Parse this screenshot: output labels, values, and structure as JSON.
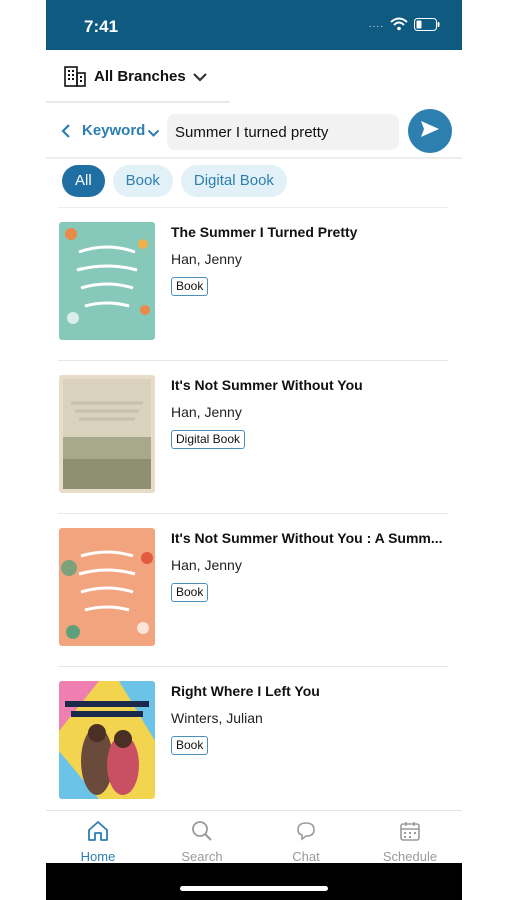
{
  "status_bar": {
    "time": "7:41",
    "signal_dots": "...."
  },
  "branch": {
    "label": "All Branches"
  },
  "search": {
    "mode_label": "Keyword",
    "query": "Summer I turned pretty",
    "placeholder": ""
  },
  "filters": [
    {
      "label": "All",
      "active": true
    },
    {
      "label": "Book",
      "active": false
    },
    {
      "label": "Digital Book",
      "active": false
    }
  ],
  "results": [
    {
      "title": "The Summer I Turned Pretty",
      "author": "Han, Jenny",
      "format": "Book",
      "cover_color": "#86c9ba"
    },
    {
      "title": "It's Not Summer Without You",
      "author": "Han, Jenny",
      "format": "Digital Book",
      "cover_color": "#e6dcc7"
    },
    {
      "title": "It's Not Summer Without You : A Summ...",
      "author": "Han, Jenny",
      "format": "Book",
      "cover_color": "#f2a47e"
    },
    {
      "title": "Right Where I Left You",
      "author": "Winters, Julian",
      "format": "Book",
      "cover_color": "#f3d44f"
    }
  ],
  "tabs": [
    {
      "label": "Home",
      "icon": "home-icon",
      "active": true
    },
    {
      "label": "Search",
      "icon": "search-icon",
      "active": false
    },
    {
      "label": "Chat",
      "icon": "chat-icon",
      "active": false
    },
    {
      "label": "Schedule",
      "icon": "calendar-icon",
      "active": false
    }
  ],
  "colors": {
    "accent": "#2d7fb0",
    "status_bar": "#0f5a80",
    "chip_bg": "#e2f0f8"
  }
}
